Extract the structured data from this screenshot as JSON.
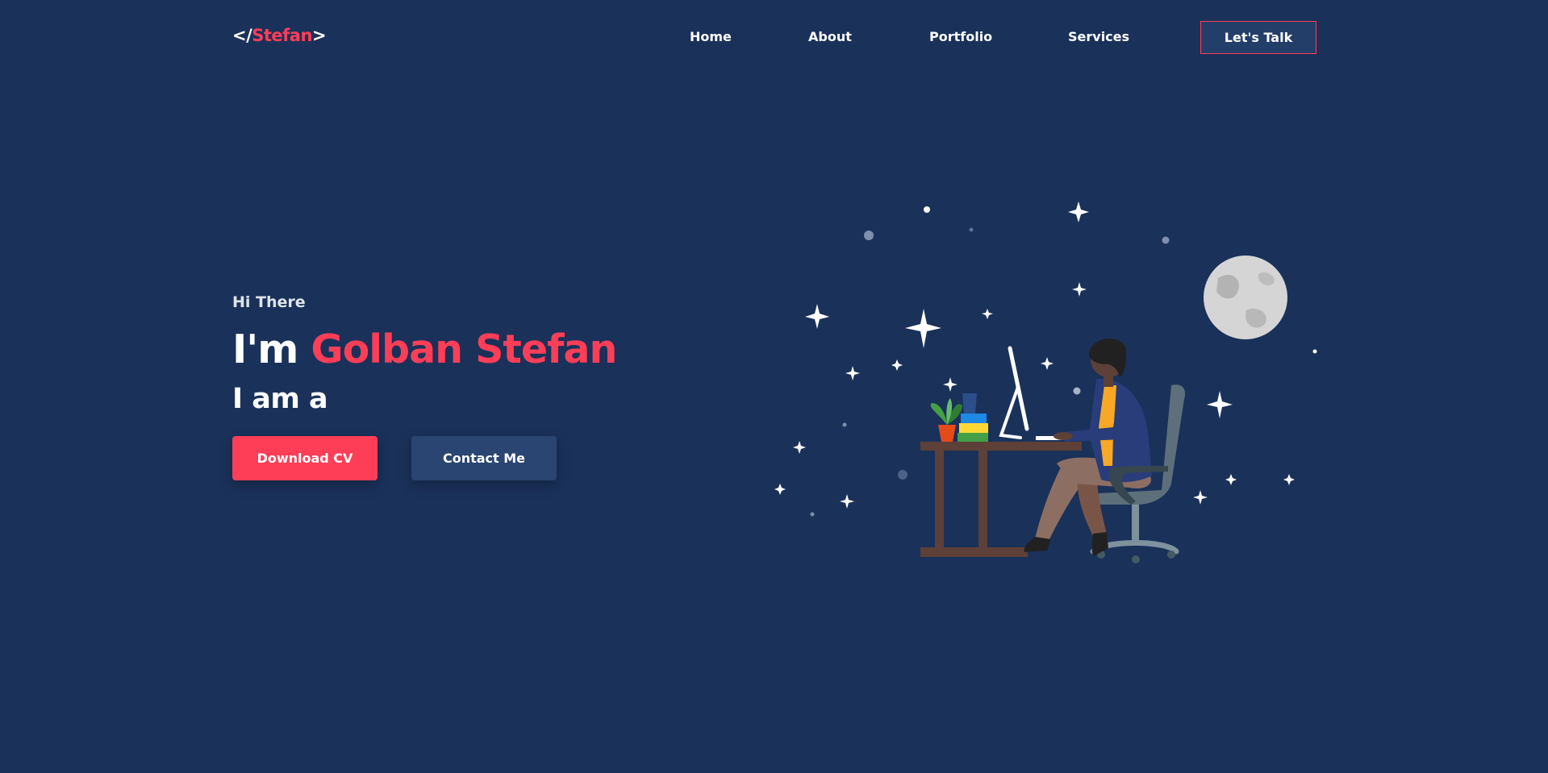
{
  "header": {
    "logo": {
      "prefix": "</",
      "name": "Stefan",
      "suffix": ">"
    },
    "nav": [
      "Home",
      "About",
      "Portfolio",
      "Services"
    ],
    "cta_label": "Let's Talk"
  },
  "hero": {
    "greeting": "Hi There",
    "title_prefix": "I'm",
    "title_name": "Golban Stefan",
    "subtitle": "I am a",
    "primary_button": "Download CV",
    "secondary_button": "Contact Me"
  },
  "colors": {
    "background": "#1a315a",
    "accent": "#fe3e57",
    "button_secondary": "#2b4572"
  },
  "illustration": {
    "icon": "developer-at-desk-illustration"
  }
}
